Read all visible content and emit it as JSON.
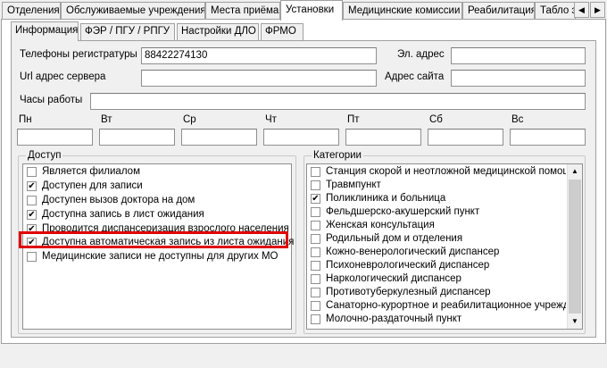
{
  "top_tabs": [
    {
      "label": "Отделения",
      "active": false
    },
    {
      "label": "Обслуживаемые учреждения",
      "active": false
    },
    {
      "label": "Места приёма",
      "active": false
    },
    {
      "label": "Установки",
      "active": true
    },
    {
      "label": "Медицинские комиссии",
      "active": false
    },
    {
      "label": "Реабилитация",
      "active": false
    },
    {
      "label": "Табло эл",
      "active": false
    }
  ],
  "tab_scroll": {
    "left_icon": "◀",
    "right_icon": "▶"
  },
  "sub_tabs": [
    {
      "label": "Информация",
      "active": true
    },
    {
      "label": "ФЭР / ПГУ / РПГУ",
      "active": false
    },
    {
      "label": "Настройки ДЛО",
      "active": false
    },
    {
      "label": "ФРМО",
      "active": false
    }
  ],
  "form": {
    "phones_label": "Телефоны регистратуры",
    "phones_value": "88422274130",
    "email_label": "Эл. адрес",
    "email_value": "",
    "server_url_label": "Url адрес сервера",
    "server_url_value": "",
    "site_label": "Адрес сайта",
    "site_value": "",
    "hours_label": "Часы работы",
    "hours_value": "",
    "days": [
      "Пн",
      "Вт",
      "Ср",
      "Чт",
      "Пт",
      "Сб",
      "Вс"
    ]
  },
  "access": {
    "title": "Доступ",
    "items": [
      {
        "label": "Является филиалом",
        "checked": false
      },
      {
        "label": "Доступен для записи",
        "checked": true
      },
      {
        "label": "Доступен вызов доктора на дом",
        "checked": false
      },
      {
        "label": "Доступна запись в лист ожидания",
        "checked": true
      },
      {
        "label": "Проводится диспансеризация взрослого населения",
        "checked": true
      },
      {
        "label": "Доступна автоматическая запись из листа ожидания",
        "checked": true
      },
      {
        "label": "Медицинские записи не доступны для других МО",
        "checked": false
      }
    ]
  },
  "categories": {
    "title": "Категории",
    "items": [
      {
        "label": "Станция скорой и неотложной медицинской помощи",
        "checked": false
      },
      {
        "label": "Травмпункт",
        "checked": false
      },
      {
        "label": "Поликлиника и больница",
        "checked": true
      },
      {
        "label": "Фельдшерско-акушерский пункт",
        "checked": false
      },
      {
        "label": "Женская консультация",
        "checked": false
      },
      {
        "label": "Родильный дом и отделения",
        "checked": false
      },
      {
        "label": "Кожно-венерологический диспансер",
        "checked": false
      },
      {
        "label": "Психоневрологический диспансер",
        "checked": false
      },
      {
        "label": "Наркологический диспансер",
        "checked": false
      },
      {
        "label": "Противотуберкулезный диспансер",
        "checked": false
      },
      {
        "label": "Санаторно-курортное и реабилитационное учреждение",
        "checked": false
      },
      {
        "label": "Молочно-раздаточный пункт",
        "checked": false
      }
    ],
    "scroll_up_icon": "▲",
    "scroll_down_icon": "▼"
  },
  "check_mark": "✔",
  "colors": {
    "highlight": "#e00000",
    "window_bg": "#f0f0f0",
    "field_border": "#8e8f8f"
  }
}
